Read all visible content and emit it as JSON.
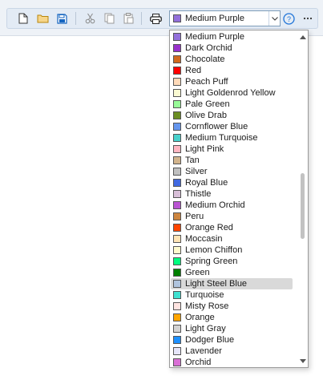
{
  "toolbar": {
    "buttons": [
      {
        "name": "new-document-button",
        "icon": "new-document-icon"
      },
      {
        "name": "open-folder-button",
        "icon": "folder-icon"
      },
      {
        "name": "save-button",
        "icon": "save-icon"
      },
      {
        "name": "cut-button",
        "icon": "scissors-icon"
      },
      {
        "name": "copy-button",
        "icon": "copy-icon"
      },
      {
        "name": "paste-button",
        "icon": "paste-icon"
      },
      {
        "name": "print-button",
        "icon": "printer-icon"
      },
      {
        "name": "help-button",
        "icon": "help-icon"
      },
      {
        "name": "more-button",
        "icon": "ellipsis-icon"
      }
    ],
    "color_select": {
      "value": "Medium Purple",
      "swatch": "#9370db"
    }
  },
  "dropdown": {
    "highlighted": "Light Steel Blue",
    "items": [
      {
        "label": "Medium Purple",
        "color": "#9370db"
      },
      {
        "label": "Dark Orchid",
        "color": "#9932cc"
      },
      {
        "label": "Chocolate",
        "color": "#d2691e"
      },
      {
        "label": "Red",
        "color": "#ff0000"
      },
      {
        "label": "Peach Puff",
        "color": "#ffdab9"
      },
      {
        "label": "Light Goldenrod Yellow",
        "color": "#fafad2"
      },
      {
        "label": "Pale Green",
        "color": "#98fb98"
      },
      {
        "label": "Olive Drab",
        "color": "#6b8e23"
      },
      {
        "label": "Cornflower Blue",
        "color": "#6495ed"
      },
      {
        "label": "Medium Turquoise",
        "color": "#48d1cc"
      },
      {
        "label": "Light Pink",
        "color": "#ffb6c1"
      },
      {
        "label": "Tan",
        "color": "#d2b48c"
      },
      {
        "label": "Silver",
        "color": "#c0c0c0"
      },
      {
        "label": "Royal Blue",
        "color": "#4169e1"
      },
      {
        "label": "Thistle",
        "color": "#d8bfd8"
      },
      {
        "label": "Medium Orchid",
        "color": "#ba55d3"
      },
      {
        "label": "Peru",
        "color": "#cd853f"
      },
      {
        "label": "Orange Red",
        "color": "#ff4500"
      },
      {
        "label": "Moccasin",
        "color": "#ffe4b5"
      },
      {
        "label": "Lemon Chiffon",
        "color": "#fffacd"
      },
      {
        "label": "Spring Green",
        "color": "#00ff7f"
      },
      {
        "label": "Green",
        "color": "#008000"
      },
      {
        "label": "Light Steel Blue",
        "color": "#b0c4de"
      },
      {
        "label": "Turquoise",
        "color": "#40e0d0"
      },
      {
        "label": "Misty Rose",
        "color": "#ffe4e1"
      },
      {
        "label": "Orange",
        "color": "#ffa500"
      },
      {
        "label": "Light Gray",
        "color": "#d3d3d3"
      },
      {
        "label": "Dodger Blue",
        "color": "#1e90ff"
      },
      {
        "label": "Lavender",
        "color": "#e6e6fa"
      },
      {
        "label": "Orchid",
        "color": "#da70d6"
      }
    ]
  }
}
